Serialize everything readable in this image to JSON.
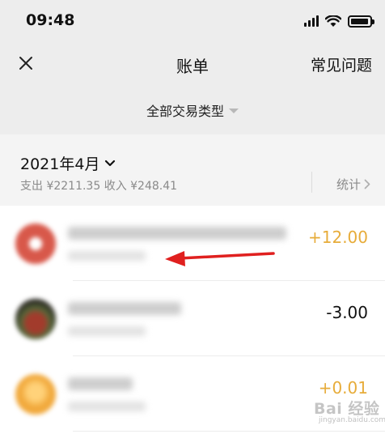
{
  "status": {
    "time": "09:48",
    "icons": [
      "signal-icon",
      "wifi-icon",
      "battery-icon"
    ]
  },
  "header": {
    "title": "账单",
    "faq_label": "常见问题",
    "close_icon": "close-icon"
  },
  "filter": {
    "label": "全部交易类型"
  },
  "month": {
    "label": "2021年4月",
    "summary": "支出 ¥2211.35 收入 ¥248.41",
    "stats_label": "统计"
  },
  "transactions": [
    {
      "amount": "+12.00",
      "type": "income",
      "avatar_color": "#d8584a"
    },
    {
      "amount": "-3.00",
      "type": "expense",
      "avatar_color": "#6d2a24"
    },
    {
      "amount": "+0.01",
      "type": "income",
      "avatar_color": "#f1a93c"
    }
  ],
  "watermark": {
    "main": "Bai 经验",
    "sub": "jingyan.baidu.com"
  },
  "colors": {
    "income": "#e7ac3a",
    "expense": "#111111",
    "header_bg": "#ededed",
    "section_bg": "#f4f4f4",
    "annotation_arrow": "#e0201f"
  }
}
